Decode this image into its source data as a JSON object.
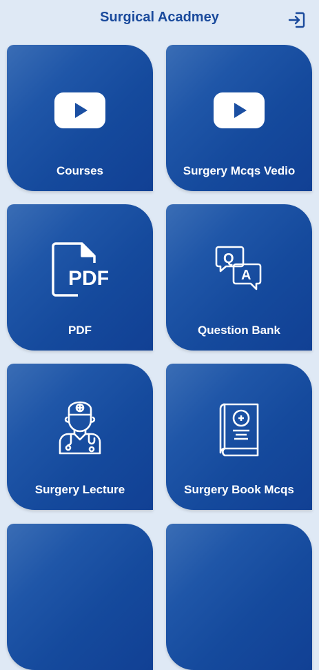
{
  "app": {
    "title": "Surgical Acadmey",
    "accent_color": "#1a4a9c",
    "logout_icon": "logout-icon"
  },
  "tiles": [
    {
      "label": "Courses",
      "icon": "youtube-play-icon"
    },
    {
      "label": "Surgery Mcqs Vedio",
      "icon": "youtube-play-icon"
    },
    {
      "label": "PDF",
      "icon": "pdf-file-icon"
    },
    {
      "label": "Question Bank",
      "icon": "question-answer-icon"
    },
    {
      "label": "Surgery Lecture",
      "icon": "doctor-icon"
    },
    {
      "label": "Surgery Book Mcqs",
      "icon": "medical-book-icon"
    }
  ]
}
